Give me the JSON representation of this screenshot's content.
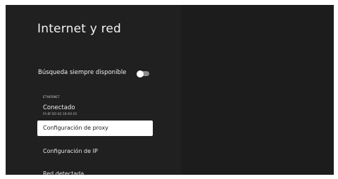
{
  "page": {
    "title": "Internet y red"
  },
  "always_scan": {
    "label": "Búsqueda siempre disponible",
    "enabled": false
  },
  "ethernet": {
    "section_label": "ETHERNET",
    "status_title": "Conectado",
    "status_detail": "FA:8F:DO:82:1B:6O:05"
  },
  "menu": {
    "proxy_label": "Configuración de proxy",
    "ip_label": "Configuración de IP",
    "network_label": "Red detectada"
  }
}
